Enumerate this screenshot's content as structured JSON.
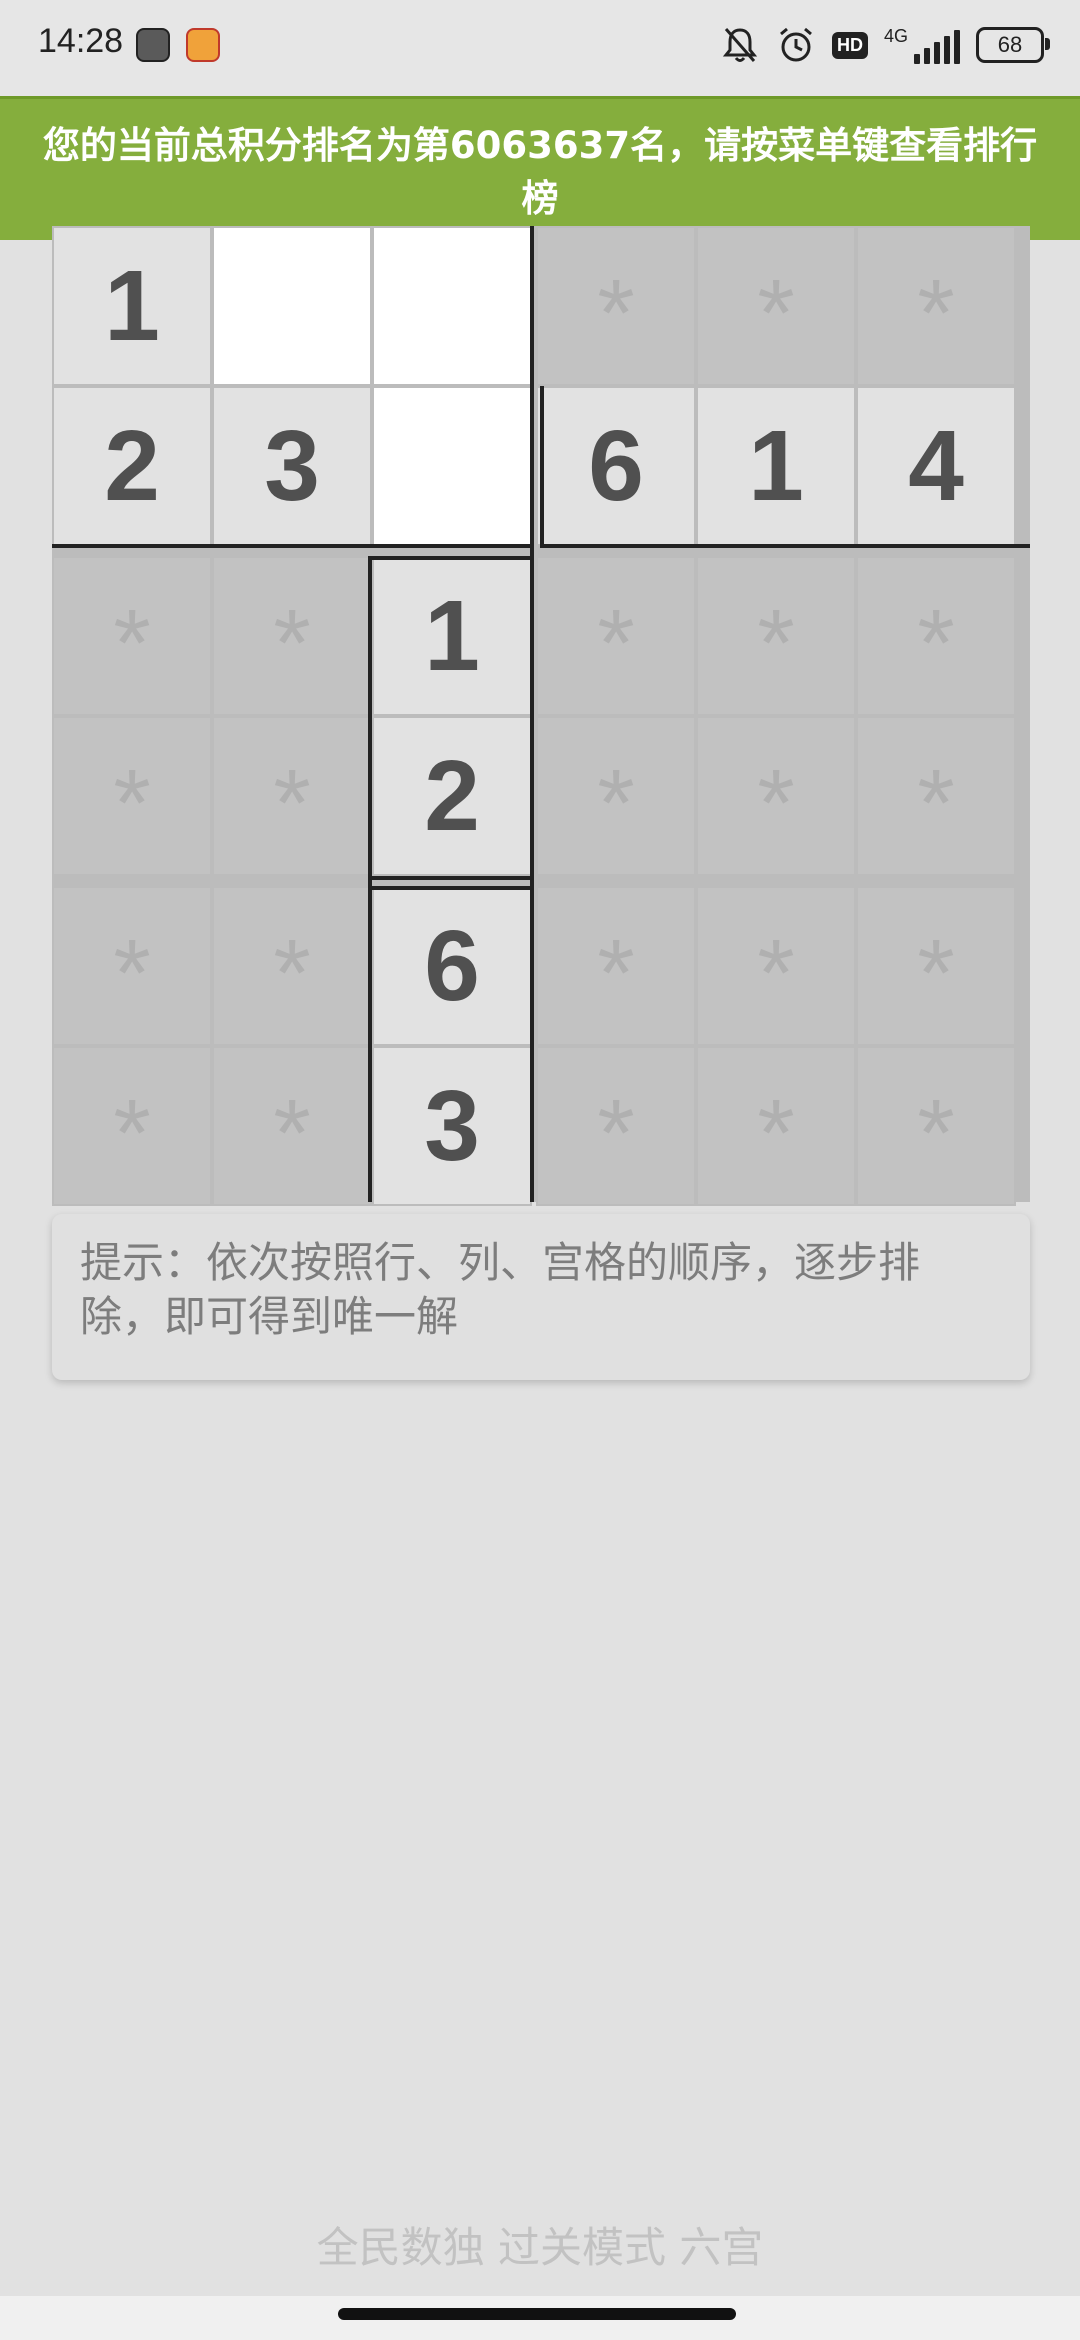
{
  "status_bar": {
    "time": "14:28",
    "network": "4G",
    "hd": "HD",
    "battery": "68",
    "icons": [
      "notification-app-icon",
      "gallery-app-icon",
      "bell-muted-icon",
      "alarm-icon",
      "hd-icon",
      "signal-icon",
      "battery-icon"
    ]
  },
  "toast": {
    "message": "您的当前总积分排名为第6063637名，请按菜单键查看排行榜"
  },
  "board": {
    "cells": [
      [
        "1",
        "",
        "",
        "*",
        "*",
        "*"
      ],
      [
        "2",
        "3",
        "",
        "6",
        "1",
        "4"
      ],
      [
        "*",
        "*",
        "1",
        "*",
        "*",
        "*"
      ],
      [
        "*",
        "*",
        "2",
        "*",
        "*",
        "*"
      ],
      [
        "*",
        "*",
        "6",
        "*",
        "*",
        "*"
      ],
      [
        "*",
        "*",
        "3",
        "*",
        "*",
        "*"
      ]
    ]
  },
  "hint": {
    "text": "提示：依次按照行、列、宫格的顺序，逐步排除，即可得到唯一解"
  },
  "footer": {
    "text": "全民数独 过关模式 六宫"
  }
}
